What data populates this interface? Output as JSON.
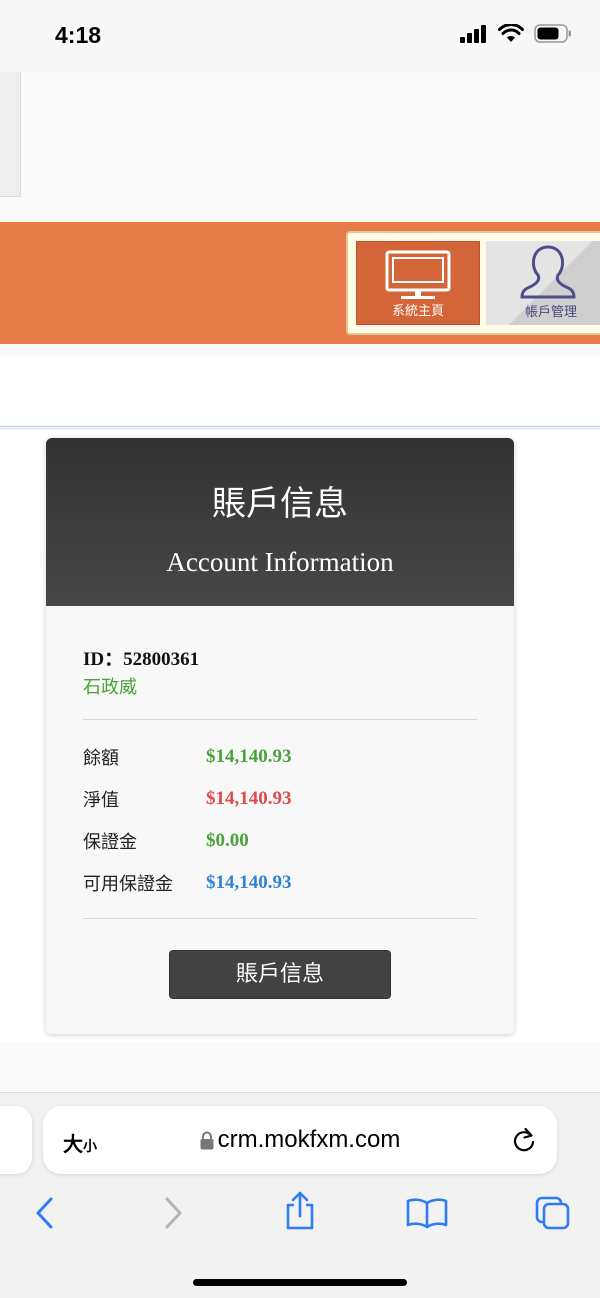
{
  "status_bar": {
    "time": "4:18"
  },
  "nav": {
    "home_label": "系統主頁",
    "account_label": "帳戶管理"
  },
  "card": {
    "title_cn": "賬戶信息",
    "title_en": "Account Information",
    "id_text": "ID：52800361",
    "name": "石政威",
    "rows": [
      {
        "label": "餘額",
        "value": "$14,140.93",
        "color": "#4aa33a"
      },
      {
        "label": "淨值",
        "value": "$14,140.93",
        "color": "#e04a4a"
      },
      {
        "label": "保證金",
        "value": "$0.00",
        "color": "#4aa33a"
      },
      {
        "label": "可用保證金",
        "value": "$14,140.93",
        "color": "#2f82d8"
      }
    ],
    "button_label": "賬戶信息"
  },
  "browser": {
    "aa_big": "大",
    "aa_small": "小",
    "url": "crm.mokfxm.com"
  },
  "colors": {
    "accent_orange": "#e67b49",
    "card_header": "#424242",
    "link_blue": "#2f7bf5"
  }
}
